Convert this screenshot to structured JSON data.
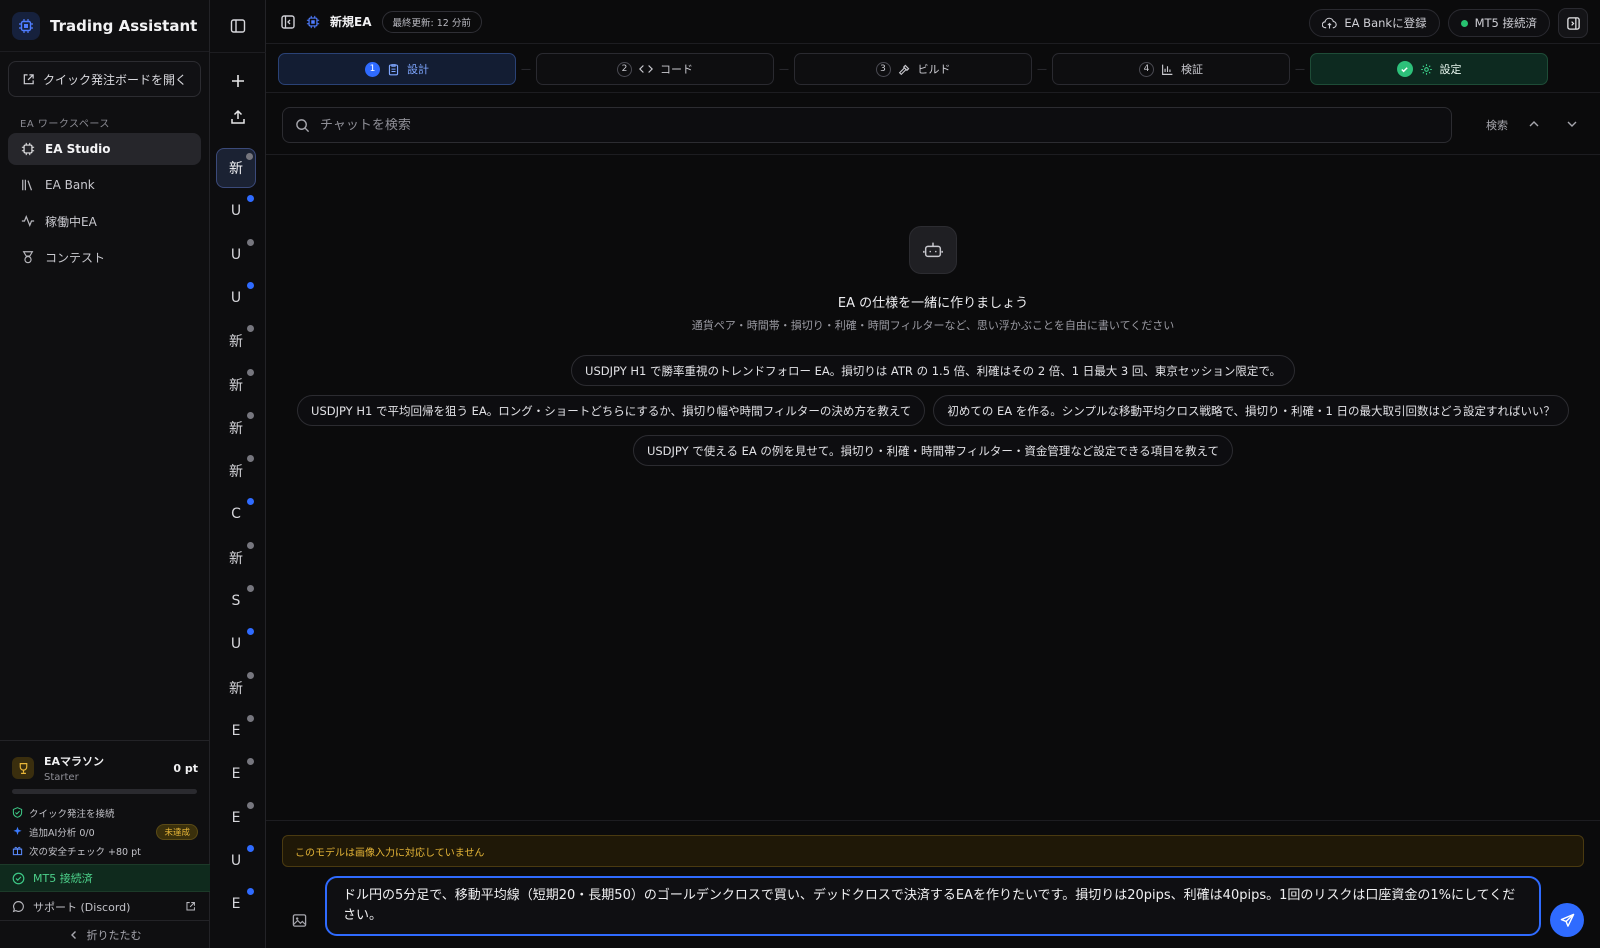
{
  "sidebar": {
    "brand": "Trading Assistant",
    "quick_order": "クイック発注ボードを開く",
    "workspace_label": "EA ワークスペース",
    "items": [
      {
        "label": "EA Studio"
      },
      {
        "label": "EA Bank"
      },
      {
        "label": "稼働中EA"
      },
      {
        "label": "コンテスト"
      }
    ],
    "marathon": {
      "title": "EAマラソン",
      "tier": "Starter",
      "points": "0 pt",
      "progress": 0
    },
    "tasks": [
      {
        "label": "クイック発注を接続"
      },
      {
        "label": "追加AI分析 0/0",
        "badge": "未達成"
      },
      {
        "label": "次の安全チェック +80 pt"
      }
    ],
    "mt5": "MT5 接続済",
    "support": "サポート (Discord)",
    "collapse": "折りたたむ"
  },
  "chat_list": [
    "新",
    "U",
    "U",
    "U",
    "新",
    "新",
    "新",
    "新",
    "C",
    "新",
    "S",
    "U",
    "新",
    "E",
    "E",
    "E",
    "U",
    "E"
  ],
  "chat_dots": [
    "gray",
    "blue",
    "gray",
    "blue",
    "gray",
    "gray",
    "gray",
    "gray",
    "blue",
    "gray",
    "gray",
    "blue",
    "gray",
    "gray",
    "gray",
    "gray",
    "blue",
    "blue"
  ],
  "topbar": {
    "ea_name": "新規EA",
    "updated": "最終更新: 12 分前",
    "register": "EA Bankに登録",
    "mt5": "MT5 接続済"
  },
  "steps": [
    {
      "num": "1",
      "label": "設計"
    },
    {
      "num": "2",
      "label": "コード"
    },
    {
      "num": "3",
      "label": "ビルド"
    },
    {
      "num": "4",
      "label": "検証"
    },
    {
      "num": "",
      "label": "設定"
    }
  ],
  "search": {
    "placeholder": "チャットを検索",
    "label": "検索"
  },
  "empty": {
    "title": "EA の仕様を一緒に作りましょう",
    "subtitle": "通貨ペア・時間帯・損切り・利確・時間フィルターなど、思い浮かぶことを自由に書いてください",
    "chips": [
      "USDJPY H1 で勝率重視のトレンドフォロー EA。損切りは ATR の 1.5 倍、利確はその 2 倍、1 日最大 3 回、東京セッション限定で。",
      "USDJPY H1 で平均回帰を狙う EA。ロング・ショートどちらにするか、損切り幅や時間フィルターの決め方を教えて",
      "初めての EA を作る。シンプルな移動平均クロス戦略で、損切り・利確・1 日の最大取引回数はどう設定すればいい？",
      "USDJPY で使える EA の例を見せて。損切り・利確・時間帯フィルター・資金管理など設定できる項目を教えて"
    ]
  },
  "composer": {
    "warning": "このモデルは画像入力に対応していません",
    "value": "ドル円の5分足で、移動平均線（短期20・長期50）のゴールデンクロスで買い、デッドクロスで決済するEAを作りたいです。損切りは20pips、利確は40pips。1回のリスクは口座資金の1%にしてください。"
  },
  "colors": {
    "accent": "#2f6bff",
    "success": "#2dc07a",
    "warning": "#e5b537"
  }
}
